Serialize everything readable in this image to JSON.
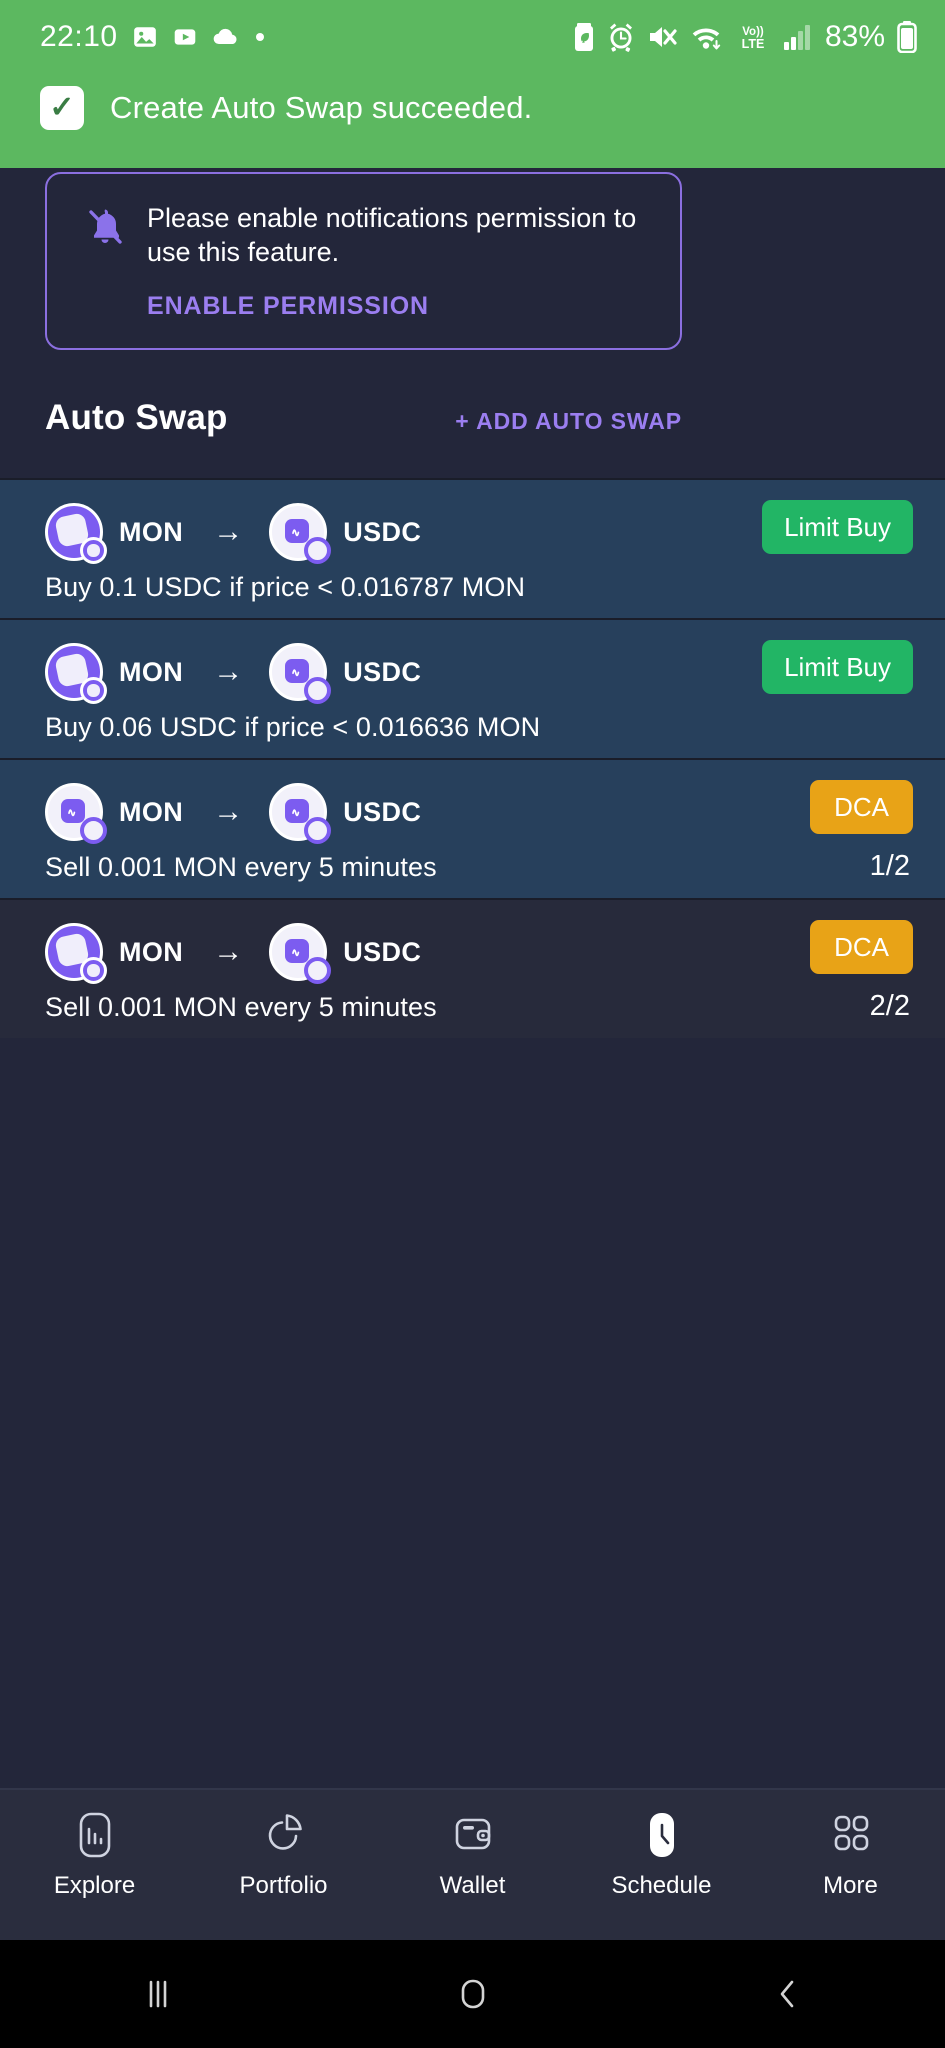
{
  "status_bar": {
    "time": "22:10",
    "battery_percent": "83%",
    "left_icons": [
      "photos-icon",
      "youtube-icon",
      "cloud-icon",
      "dot-icon"
    ],
    "right_icons": [
      "battery-saver-icon",
      "alarm-icon",
      "mute-icon",
      "wifi-icon",
      "volte-icon",
      "signal-icon",
      "battery-icon"
    ]
  },
  "snackbar": {
    "message": "Create Auto Swap succeeded.",
    "icon": "check-icon",
    "background": "#5cb860"
  },
  "permission_card": {
    "icon": "bell-off-icon",
    "message": "Please enable notifications permission to use this feature.",
    "action_label": "ENABLE PERMISSION",
    "accent": "#9b7ef0"
  },
  "section": {
    "title": "Auto Swap",
    "action_label": "+ ADD AUTO SWAP"
  },
  "swaps": [
    {
      "from_token": "MON",
      "to_token": "USDC",
      "from_icon": "mon-token-icon",
      "to_icon": "usdc-token-icon",
      "arrow": "→",
      "badge": "Limit Buy",
      "badge_type": "limit",
      "badge_color": "#22b565",
      "description": "Buy 0.1 USDC if price  <  0.016787 MON",
      "count": "",
      "row_background": "#27405c",
      "edge_top_color": "#e9ecf5",
      "edge_bottom_color": "#e9ecf5"
    },
    {
      "from_token": "MON",
      "to_token": "USDC",
      "from_icon": "mon-token-icon",
      "to_icon": "usdc-token-icon",
      "arrow": "→",
      "badge": "Limit Buy",
      "badge_type": "limit",
      "badge_color": "#22b565",
      "description": "Buy 0.06 USDC if price  <  0.016636 MON",
      "count": "",
      "row_background": "#27405c",
      "edge_top_color": "#e9ecf5",
      "edge_bottom_color": "#e9ecf5"
    },
    {
      "from_token": "MON",
      "to_token": "USDC",
      "from_icon": "usdc-token-icon",
      "to_icon": "usdc-token-icon",
      "arrow": "→",
      "badge": "DCA",
      "badge_type": "dca",
      "badge_color": "#e8a317",
      "description": "Sell 0.001 MON every 5 minutes",
      "count": "1/2",
      "row_background": "#27405c",
      "edge_top_color": "#e9ecf5",
      "edge_bottom_color": "#17a865"
    },
    {
      "from_token": "MON",
      "to_token": "USDC",
      "from_icon": "mon-token-icon",
      "to_icon": "usdc-token-icon",
      "arrow": "→",
      "badge": "DCA",
      "badge_type": "dca",
      "badge_color": "#e8a317",
      "description": "Sell 0.001 MON every 5 minutes",
      "count": "2/2",
      "row_background": "#272a3b",
      "edge_top_color": "#17a865",
      "edge_bottom_color": "#17a865"
    }
  ],
  "tabbar": {
    "items": [
      {
        "label": "Explore",
        "icon": "bar-chart-icon",
        "active": false
      },
      {
        "label": "Portfolio",
        "icon": "pie-chart-icon",
        "active": false
      },
      {
        "label": "Wallet",
        "icon": "wallet-icon",
        "active": false
      },
      {
        "label": "Schedule",
        "icon": "clock-icon",
        "active": true
      },
      {
        "label": "More",
        "icon": "grid-icon",
        "active": false
      }
    ]
  },
  "android_nav": {
    "recents": "recents-icon",
    "home": "home-icon",
    "back": "back-icon"
  }
}
